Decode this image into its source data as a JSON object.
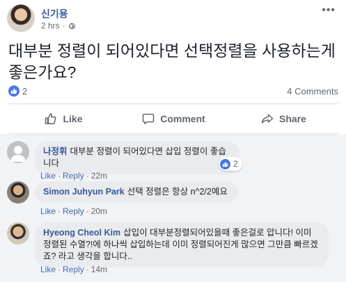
{
  "post": {
    "author": "신기용",
    "time": "2 hrs",
    "text_line1": "대부분 정렬이 되어있다면 선택정렬을 사용하는게",
    "text_line2": "좋은가요?",
    "like_count": "2",
    "comments_count": "4 Comments"
  },
  "actions": {
    "like": "Like",
    "comment": "Comment",
    "share": "Share"
  },
  "comments": [
    {
      "author": "나정휘",
      "text": "대부분 정렬이 되어있다면 삽입 정렬이 좋습니다",
      "like": "Like",
      "reply": "Reply",
      "time": "22m",
      "reaction_count": "2"
    },
    {
      "author": "Simon Juhyun Park",
      "text": "선택 정렬은 항상 n^2/2예요",
      "like": "Like",
      "reply": "Reply",
      "time": "20m"
    },
    {
      "author": "Hyeong Cheol Kim",
      "text_line1": "삽입이 대부분정렬되어있을때 좋은걸로 압니다! 이미",
      "text_line2": "정렬된 수열?!에 하나씩 삽입하는데 이미 정렬되어진게 많으면 그만큼 빠르겠",
      "text_line3": "죠? 라고 생각을 합니다..",
      "like": "Like",
      "reply": "Reply",
      "time": "14m"
    }
  ],
  "colors": {
    "link_blue": "#385898",
    "action_gray": "#606770",
    "like_blue": "#4a76e8",
    "comment_bg": "#f2f3f5",
    "bubble_bg": "#e9ebee"
  }
}
